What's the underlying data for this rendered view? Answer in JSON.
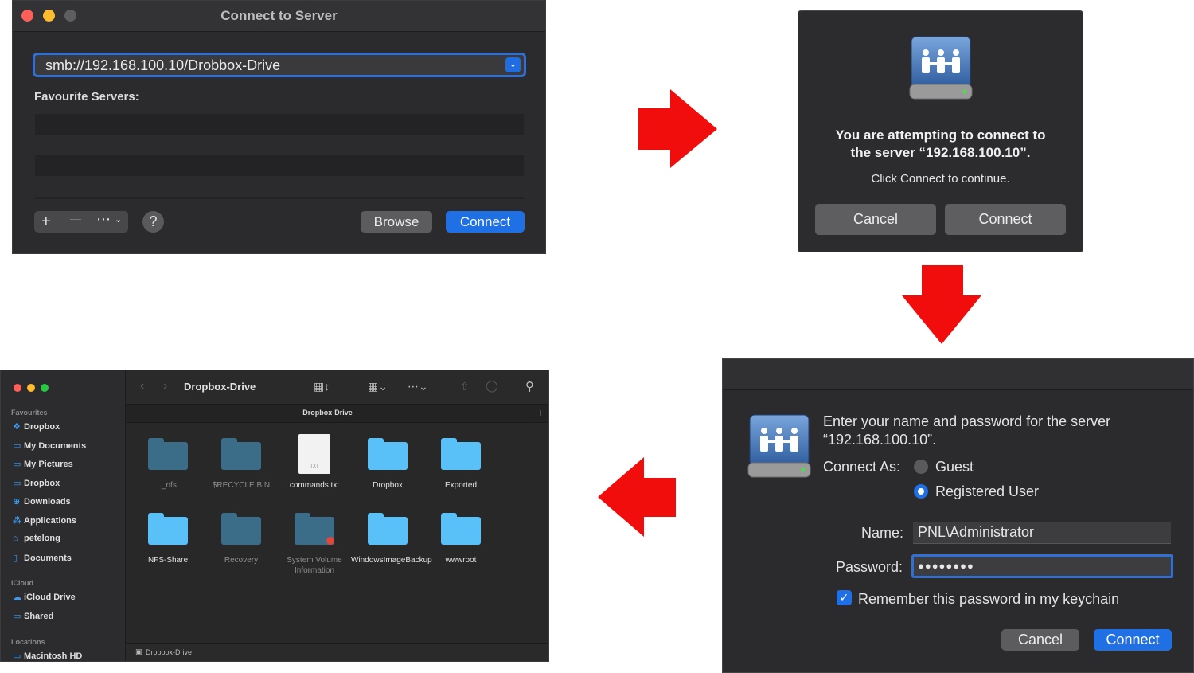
{
  "connect_to_server": {
    "title": "Connect to Server",
    "address": "smb://192.168.100.10/Drobbox-Drive",
    "favourites_label": "Favourite Servers:",
    "add": "+",
    "remove": "—",
    "more": "⋯",
    "help": "?",
    "browse": "Browse",
    "connect": "Connect"
  },
  "confirm_dialog": {
    "message_line1": "You are attempting to connect to",
    "message_line2": "the server “192.168.100.10”.",
    "sub": "Click Connect to continue.",
    "cancel": "Cancel",
    "connect": "Connect"
  },
  "login_dialog": {
    "prompt_line1": "Enter your name and password for the server",
    "prompt_line2": "“192.168.100.10”.",
    "connect_as_label": "Connect As:",
    "guest": "Guest",
    "registered": "Registered User",
    "selected": "Registered User",
    "name_label": "Name:",
    "name_value": "PNL\\Administrator",
    "password_label": "Password:",
    "password_value": "●●●●●●●●",
    "remember": "Remember this password in my keychain",
    "remember_checked": true,
    "cancel": "Cancel",
    "connect": "Connect"
  },
  "finder": {
    "title": "Dropbox-Drive",
    "path_title": "Dropbox-Drive",
    "status_path": "Dropbox-Drive",
    "sidebar": {
      "favourites_label": "Favourites",
      "favourites": [
        {
          "label": "Dropbox",
          "icon": "dropbox-icon"
        },
        {
          "label": "My Documents",
          "icon": "folder-icon"
        },
        {
          "label": "My Pictures",
          "icon": "folder-icon"
        },
        {
          "label": "Dropbox",
          "icon": "folder-icon"
        },
        {
          "label": "Downloads",
          "icon": "download-icon"
        },
        {
          "label": "Applications",
          "icon": "applications-icon"
        },
        {
          "label": "petelong",
          "icon": "home-icon"
        },
        {
          "label": "Documents",
          "icon": "document-icon"
        }
      ],
      "icloud_label": "iCloud",
      "icloud": [
        {
          "label": "iCloud Drive",
          "icon": "cloud-icon"
        },
        {
          "label": "Shared",
          "icon": "shared-folder-icon"
        }
      ],
      "locations_label": "Locations",
      "locations": [
        {
          "label": "Macintosh HD",
          "icon": "disk-icon"
        }
      ]
    },
    "items": [
      {
        "name": "._nfs",
        "dim": true,
        "kind": "folder"
      },
      {
        "name": "$RECYCLE.BIN",
        "dim": true,
        "kind": "folder"
      },
      {
        "name": "commands.txt",
        "dim": false,
        "kind": "file"
      },
      {
        "name": "Dropbox",
        "dim": false,
        "kind": "folder"
      },
      {
        "name": "Exported",
        "dim": false,
        "kind": "folder"
      },
      {
        "name": "NFS-Share",
        "dim": false,
        "kind": "folder"
      },
      {
        "name": "Recovery",
        "dim": true,
        "kind": "folder"
      },
      {
        "name": "System Volume Information",
        "dim": true,
        "kind": "folder-restricted"
      },
      {
        "name": "WindowsImageBackup",
        "dim": false,
        "kind": "folder"
      },
      {
        "name": "wwwroot",
        "dim": false,
        "kind": "folder"
      }
    ],
    "txt_badge": "TXT"
  },
  "colors": {
    "arrow": "#f20d0d",
    "accent": "#1f6fe5",
    "folder_light": "#5ac0f8",
    "folder_dim": "#3b6d89"
  }
}
